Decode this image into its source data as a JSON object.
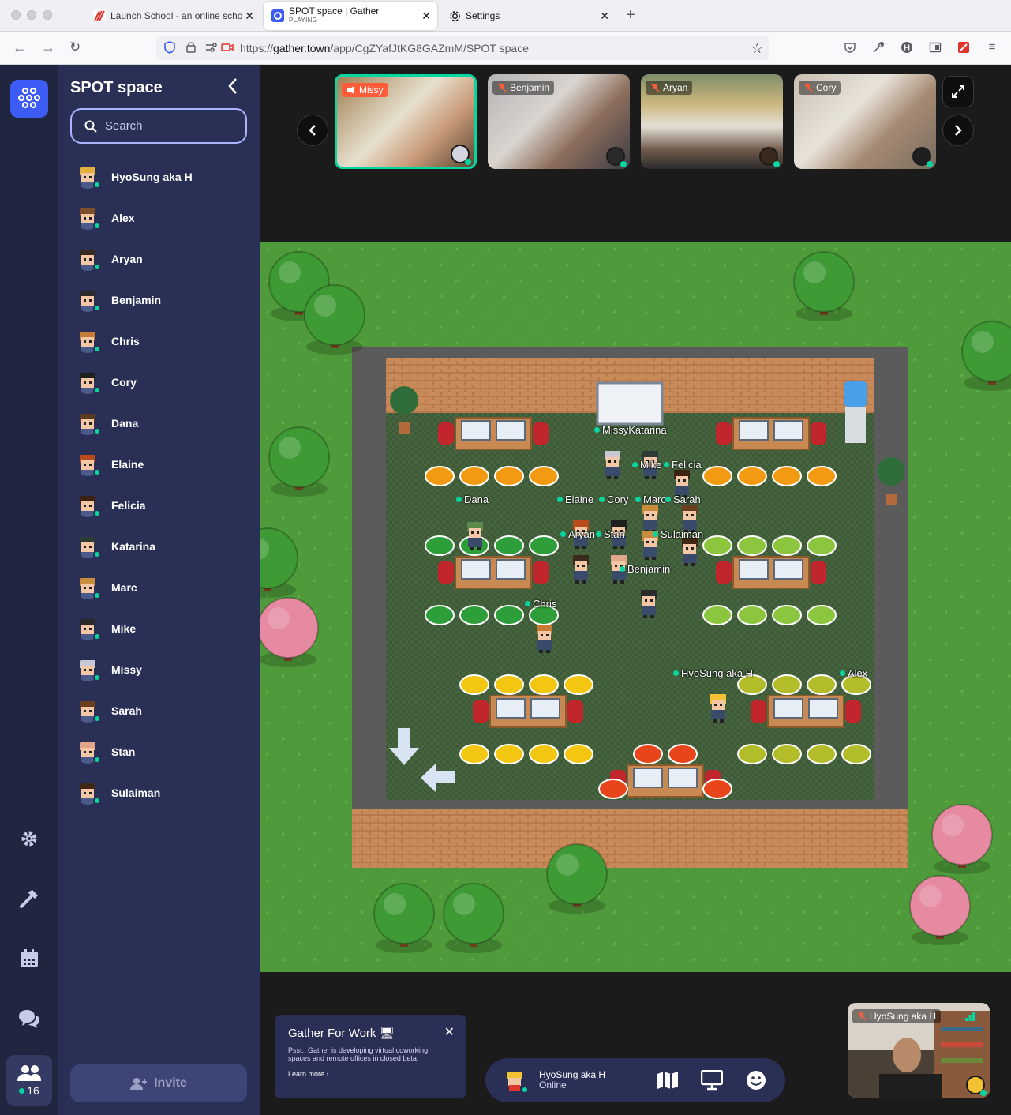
{
  "browser": {
    "tabs": [
      {
        "title": "Launch School - an online scho",
        "sub": "",
        "active": false
      },
      {
        "title": "SPOT space | Gather",
        "sub": "PLAYING",
        "active": true
      },
      {
        "title": "Settings",
        "sub": "",
        "active": false
      }
    ],
    "url_prefix": "https://",
    "url_domain": "gather.town",
    "url_path": "/app/CgZYafJtKG8GAZmM/SPOT space"
  },
  "sidebar": {
    "space_title": "SPOT space",
    "search_placeholder": "Search",
    "invite_label": "Invite",
    "people": [
      {
        "name": "HyoSung aka H",
        "color": "#e2b13c"
      },
      {
        "name": "Alex",
        "color": "#7b4f2c"
      },
      {
        "name": "Aryan",
        "color": "#3a2a1e"
      },
      {
        "name": "Benjamin",
        "color": "#2b2b2b"
      },
      {
        "name": "Chris",
        "color": "#c77b34"
      },
      {
        "name": "Cory",
        "color": "#1f1f1f"
      },
      {
        "name": "Dana",
        "color": "#5a3b22"
      },
      {
        "name": "Elaine",
        "color": "#b84a1c"
      },
      {
        "name": "Felicia",
        "color": "#3b2212"
      },
      {
        "name": "Katarina",
        "color": "#2d3b34"
      },
      {
        "name": "Marc",
        "color": "#c98b3c"
      },
      {
        "name": "Mike",
        "color": "#2a2a2a"
      },
      {
        "name": "Missy",
        "color": "#c9c9d6"
      },
      {
        "name": "Sarah",
        "color": "#6b3e1f"
      },
      {
        "name": "Stan",
        "color": "#e0a58a"
      },
      {
        "name": "Sulaiman",
        "color": "#3f2615"
      }
    ]
  },
  "rail": {
    "people_count": "16"
  },
  "videos": [
    {
      "name": "Missy",
      "speaking": true,
      "muted": false
    },
    {
      "name": "Benjamin",
      "speaking": false,
      "muted": true
    },
    {
      "name": "Aryan",
      "speaking": false,
      "muted": true
    },
    {
      "name": "Cory",
      "speaking": false,
      "muted": true
    }
  ],
  "map_labels": [
    {
      "text": "MissyKatarina"
    },
    {
      "text": "Mike"
    },
    {
      "text": "Felicia"
    },
    {
      "text": "Dana"
    },
    {
      "text": "Elaine"
    },
    {
      "text": "Cory"
    },
    {
      "text": "Marc"
    },
    {
      "text": "Sarah"
    },
    {
      "text": "Aryan"
    },
    {
      "text": "Stan"
    },
    {
      "text": "Sulaiman"
    },
    {
      "text": "Benjamin"
    },
    {
      "text": "Chris"
    },
    {
      "text": "HyoSung aka H"
    },
    {
      "text": "Alex"
    }
  ],
  "promo": {
    "title": "Gather For Work",
    "body": "Psst.. Gather is developing virtual coworking spaces and remote offices in closed beta.",
    "link": "Learn more ›"
  },
  "bottombar": {
    "name": "HyoSung aka H",
    "status": "Online"
  },
  "selfview": {
    "name": "HyoSung aka H"
  },
  "colors": {
    "accent": "#3d5cf6",
    "online": "#06d6a0",
    "sidebar_bg": "#2a2f56",
    "rail_bg": "#202540",
    "speaking": "#ff5c3a"
  }
}
